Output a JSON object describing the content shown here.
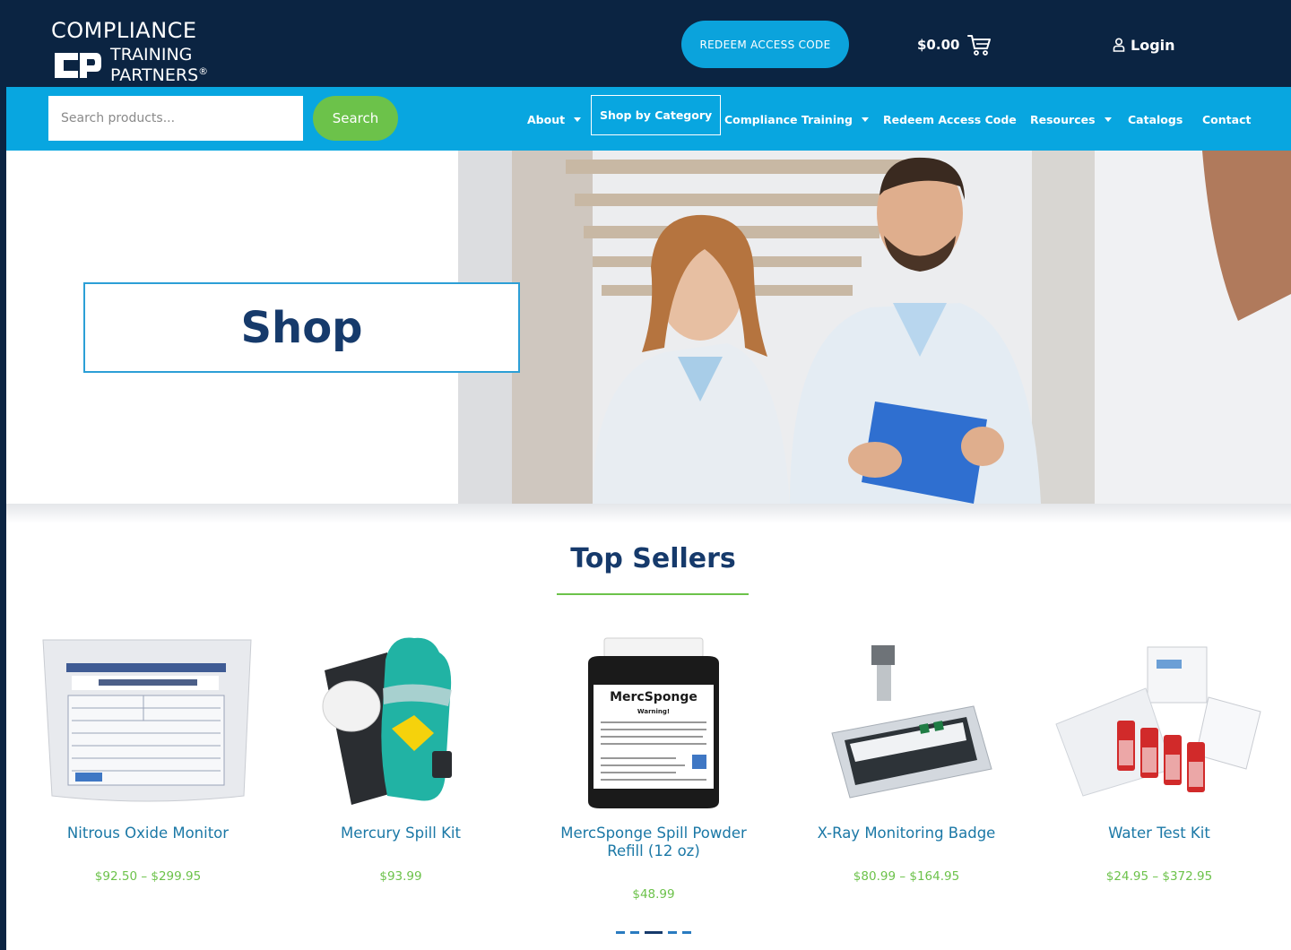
{
  "brand": {
    "line1": "COMPLIANCE",
    "line2": "TRAINING",
    "line3": "PARTNERS",
    "registered": "®"
  },
  "header": {
    "redeem_button": "REDEEM ACCESS CODE",
    "cart_amount": "$0.00",
    "login_label": "Login"
  },
  "search": {
    "placeholder": "Search products...",
    "button": "Search"
  },
  "nav": {
    "items": [
      {
        "label": "About",
        "dropdown": true
      },
      {
        "label": "Shop by Category",
        "dropdown": false,
        "active": true
      },
      {
        "label": "Compliance Training",
        "dropdown": true
      },
      {
        "label": "Redeem Access Code",
        "dropdown": false
      },
      {
        "label": "Resources",
        "dropdown": true
      },
      {
        "label": "Catalogs",
        "dropdown": false
      },
      {
        "label": "Contact",
        "dropdown": false
      }
    ]
  },
  "hero": {
    "title": "Shop"
  },
  "top_sellers": {
    "title": "Top Sellers",
    "products": [
      {
        "name": "Nitrous Oxide Monitor",
        "price": "$92.50 – $299.95",
        "icon": "nitrous-oxide-monitor-image"
      },
      {
        "name": "Mercury Spill Kit",
        "price": "$93.99",
        "icon": "mercury-spill-kit-image"
      },
      {
        "name": "MercSponge Spill Powder Refill (12 oz)",
        "price": "$48.99",
        "icon": "mercsponge-refill-image",
        "label": "MercSponge",
        "sublabel": "Warning!"
      },
      {
        "name": "X-Ray Monitoring Badge",
        "price": "$80.99 – $164.95",
        "icon": "xray-badge-image"
      },
      {
        "name": "Water Test Kit",
        "price": "$24.95 – $372.95",
        "icon": "water-test-kit-image"
      }
    ],
    "carousel_active": 3,
    "carousel_count": 5
  },
  "colors": {
    "navy": "#0b2442",
    "blue": "#08a6e0",
    "green": "#6cc24a",
    "title_navy": "#163a6b",
    "link_blue": "#1b78a6"
  }
}
